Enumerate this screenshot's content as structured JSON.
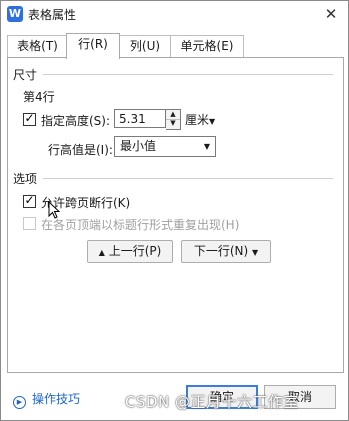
{
  "window": {
    "title": "表格属性",
    "app_icon_letter": "W"
  },
  "tabs": [
    {
      "label": "表格(T)"
    },
    {
      "label": "行(R)"
    },
    {
      "label": "列(U)"
    },
    {
      "label": "单元格(E)"
    }
  ],
  "size_section": {
    "heading": "尺寸",
    "row_label": "第4行",
    "specify_height": {
      "label": "指定高度(S):",
      "checked": true,
      "value": "5.31",
      "unit": "厘米"
    },
    "height_mode": {
      "label": "行高值是(I):",
      "selected": "最小值"
    }
  },
  "options_section": {
    "heading": "选项",
    "allow_break": {
      "label": "允许跨页断行(K)",
      "checked": true
    },
    "repeat_header": {
      "label": "在各页顶端以标题行形式重复出现(H)",
      "checked": false,
      "disabled": true
    }
  },
  "nav_buttons": {
    "prev_label": "上一行(P)",
    "next_label": "下一行(N)"
  },
  "footer": {
    "help_label": "操作技巧",
    "ok_label": "确定",
    "cancel_label": "取消"
  },
  "watermark": "CSDN @正月十六工作室"
}
